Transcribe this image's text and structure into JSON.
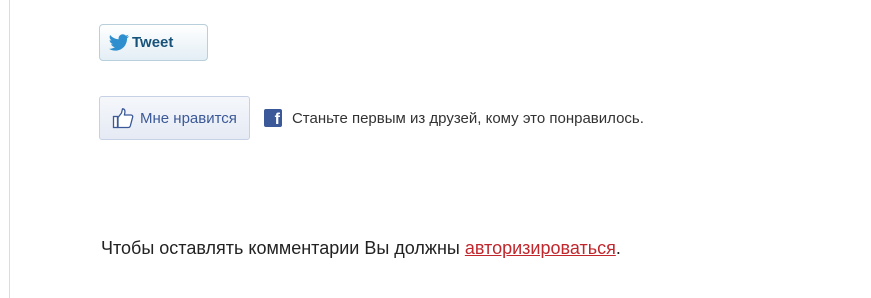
{
  "tweet": {
    "label": "Tweet",
    "icon": "twitter-bird-icon",
    "color": "#17527a"
  },
  "like": {
    "label": "Мне нравится",
    "icon": "thumbs-up-icon",
    "color": "#3b5998",
    "social_icon": "facebook-icon",
    "social_text": "Станьте первым из друзей, кому это понравилось."
  },
  "comments": {
    "notice_text": "Чтобы оставлять комментарии Вы должны ",
    "login_link": "авторизироваться",
    "notice_end": ".",
    "link_color": "#c0272d"
  }
}
